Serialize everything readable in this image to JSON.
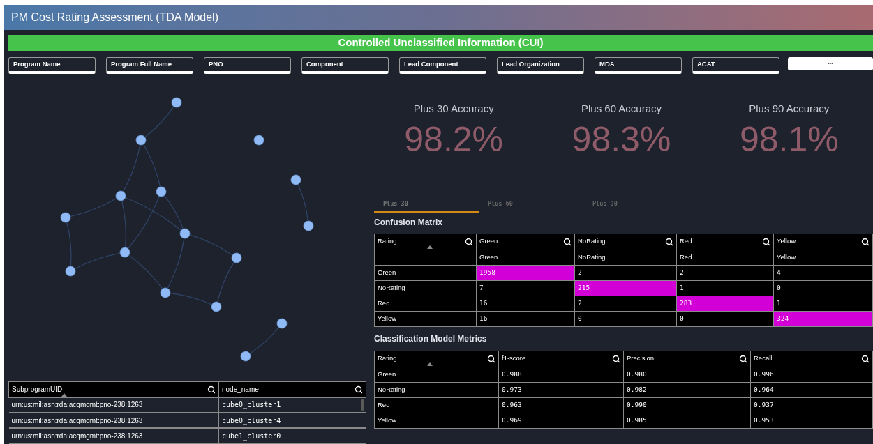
{
  "window": {
    "title": "PM Cost Rating Assessment (TDA Model)"
  },
  "banner": "Controlled Unclassified Information (CUI)",
  "filters": [
    "Program Name",
    "Program Full Name",
    "PNO",
    "Component",
    "Lead Component",
    "Lead Organization",
    "MDA",
    "ACAT"
  ],
  "more_button": "•••",
  "kpis": [
    {
      "label": "Plus 30 Accuracy",
      "value": "98.2%"
    },
    {
      "label": "Plus 60 Accuracy",
      "value": "98.3%"
    },
    {
      "label": "Plus 90 Accuracy",
      "value": "98.1%"
    }
  ],
  "tabs": [
    {
      "label": "Plus 30",
      "selected": true
    },
    {
      "label": "Plus 60",
      "selected": false
    },
    {
      "label": "Plus 90",
      "selected": false
    }
  ],
  "subprogram_table": {
    "columns": [
      {
        "label": "SubprogramUID",
        "sorted": true
      },
      {
        "label": "node_name",
        "sorted": false
      }
    ],
    "rows": [
      [
        "urn:us:mil:asn:rda:acqmgmt:pno-238:1263",
        "cube0_cluster1"
      ],
      [
        "urn:us:mil:asn:rda:acqmgmt:pno-238:1263",
        "cube0_cluster4"
      ],
      [
        "urn:us:mil:asn:rda:acqmgmt:pno-238:1263",
        "cube1_cluster0"
      ]
    ]
  },
  "confusion_matrix": {
    "title": "Confusion Matrix",
    "columns": [
      {
        "label": "Rating",
        "sorted": true
      },
      {
        "label": "Green",
        "sorted": false
      },
      {
        "label": "NoRating",
        "sorted": false
      },
      {
        "label": "Red",
        "sorted": false
      },
      {
        "label": "Yellow",
        "sorted": false
      }
    ],
    "subheader": [
      "Green",
      "NoRating",
      "Red",
      "Yellow"
    ],
    "rows": [
      {
        "cells": [
          {
            "text": "Green",
            "highlighted": false
          },
          {
            "text": "1958",
            "highlighted": true
          },
          {
            "text": "2",
            "highlighted": false
          },
          {
            "text": "2",
            "highlighted": false
          },
          {
            "text": "4",
            "highlighted": false
          }
        ]
      },
      {
        "cells": [
          {
            "text": "NoRating",
            "highlighted": false
          },
          {
            "text": "7",
            "highlighted": false
          },
          {
            "text": "215",
            "highlighted": true
          },
          {
            "text": "1",
            "highlighted": false
          },
          {
            "text": "0",
            "highlighted": false
          }
        ]
      },
      {
        "cells": [
          {
            "text": "Red",
            "highlighted": false
          },
          {
            "text": "16",
            "highlighted": false
          },
          {
            "text": "2",
            "highlighted": false
          },
          {
            "text": "283",
            "highlighted": true
          },
          {
            "text": "1",
            "highlighted": false
          }
        ]
      },
      {
        "cells": [
          {
            "text": "Yellow",
            "highlighted": false
          },
          {
            "text": "16",
            "highlighted": false
          },
          {
            "text": "0",
            "highlighted": false
          },
          {
            "text": "0",
            "highlighted": false
          },
          {
            "text": "324",
            "highlighted": true
          }
        ]
      }
    ]
  },
  "metrics": {
    "title": "Classification Model Metrics",
    "columns": [
      {
        "label": "Rating",
        "sorted": true
      },
      {
        "label": "f1-score",
        "sorted": false
      },
      {
        "label": "Precision",
        "sorted": false
      },
      {
        "label": "Recall",
        "sorted": false
      }
    ],
    "rows": [
      [
        "Green",
        "0.988",
        "0.980",
        "0.996"
      ],
      [
        "NoRating",
        "0.973",
        "0.982",
        "0.964"
      ],
      [
        "Red",
        "0.963",
        "0.990",
        "0.937"
      ],
      [
        "Yellow",
        "0.969",
        "0.985",
        "0.953"
      ]
    ]
  }
}
